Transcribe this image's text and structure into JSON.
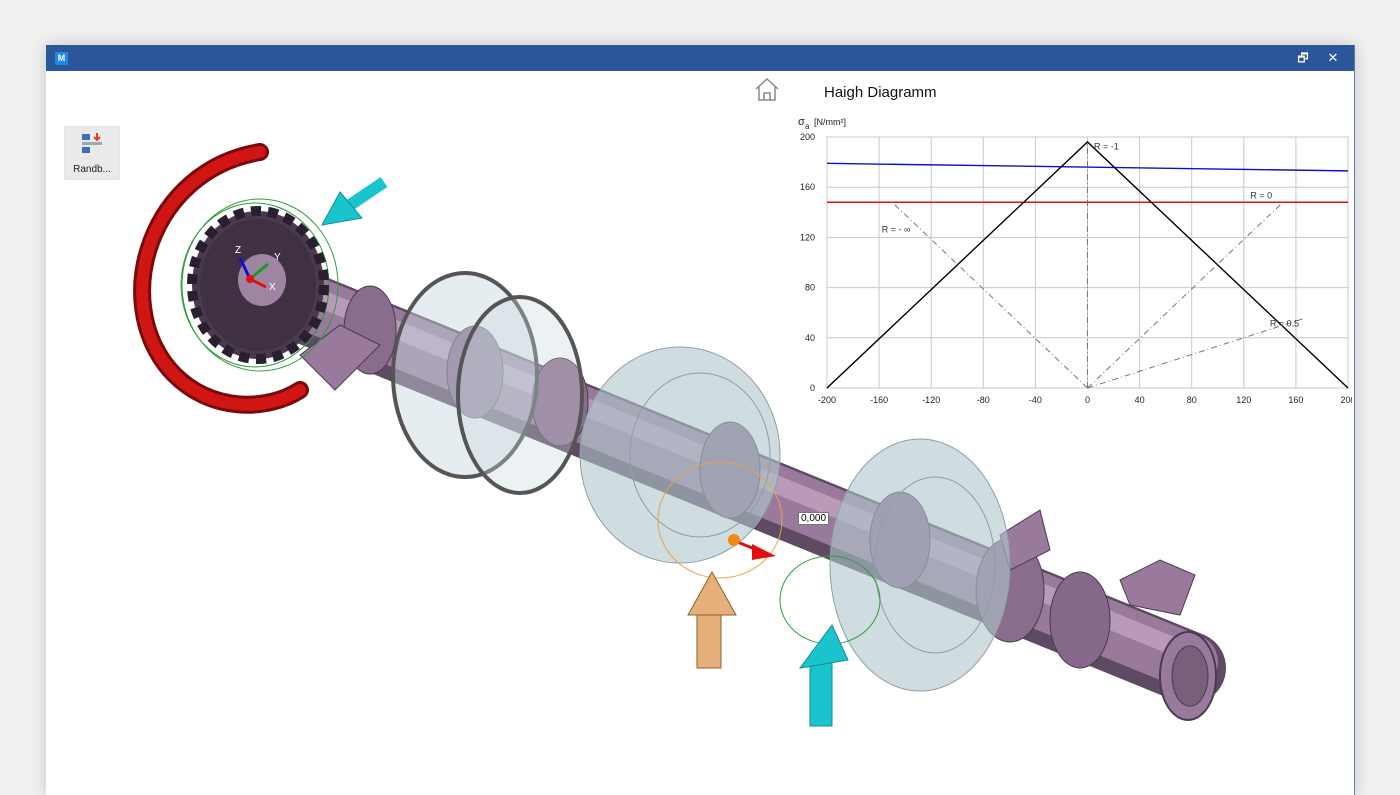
{
  "window": {
    "app_icon": "M",
    "restore_glyph": "🗗",
    "close_glyph": "✕"
  },
  "toolbar": {
    "boundary_button_label": "Randb..."
  },
  "viewport": {
    "axes": {
      "x": "X",
      "y": "Y",
      "z": "Z"
    },
    "dimension_value": "0,000",
    "colors": {
      "shaft": "#9a7a9c",
      "bearing": "#b0c6cc",
      "torque_arrow": "#c01010",
      "force_cyan": "#19c4cc",
      "force_tan": "#e6b07a"
    }
  },
  "diagram": {
    "title": "Haigh Diagramm"
  },
  "chart_data": {
    "type": "line",
    "ylabel_symbol": "σ",
    "ylabel_sub": "a",
    "ylabel_unit": "[N/mm²]",
    "xlim": [
      -200,
      200
    ],
    "ylim": [
      0,
      200
    ],
    "x_ticks": [
      "-200",
      "-160",
      "-120",
      "-80",
      "-40",
      "0",
      "40",
      "80",
      "120",
      "160",
      "200"
    ],
    "y_ticks": [
      "0",
      "40",
      "80",
      "120",
      "160",
      "200"
    ],
    "grid": true,
    "series": [
      {
        "color": "#1010c8",
        "style": "solid",
        "x": [
          -200,
          200
        ],
        "y": [
          179,
          173
        ]
      },
      {
        "color": "#e01010",
        "style": "solid",
        "x": [
          -200,
          200
        ],
        "y": [
          148,
          148
        ]
      },
      {
        "color": "#000000",
        "style": "solid",
        "x": [
          -200,
          0,
          200
        ],
        "y": [
          0,
          196,
          0
        ]
      },
      {
        "color": "#777777",
        "style": "dashdot",
        "x": [
          0,
          0
        ],
        "y": [
          0,
          196
        ]
      },
      {
        "color": "#777777",
        "style": "dashdot",
        "x": [
          0,
          -150
        ],
        "y": [
          0,
          148
        ]
      },
      {
        "color": "#777777",
        "style": "dashdot",
        "x": [
          0,
          150
        ],
        "y": [
          0,
          148
        ]
      },
      {
        "color": "#777777",
        "style": "dashdot",
        "x": [
          0,
          165
        ],
        "y": [
          0,
          55
        ]
      }
    ],
    "annotations": [
      {
        "text": "R = -1",
        "x": 5,
        "y": 190
      },
      {
        "text": "R = 0",
        "x": 125,
        "y": 151
      },
      {
        "text": "R = - ∞",
        "x": -158,
        "y": 124
      },
      {
        "text": "R = 0.5",
        "x": 140,
        "y": 49
      }
    ]
  }
}
